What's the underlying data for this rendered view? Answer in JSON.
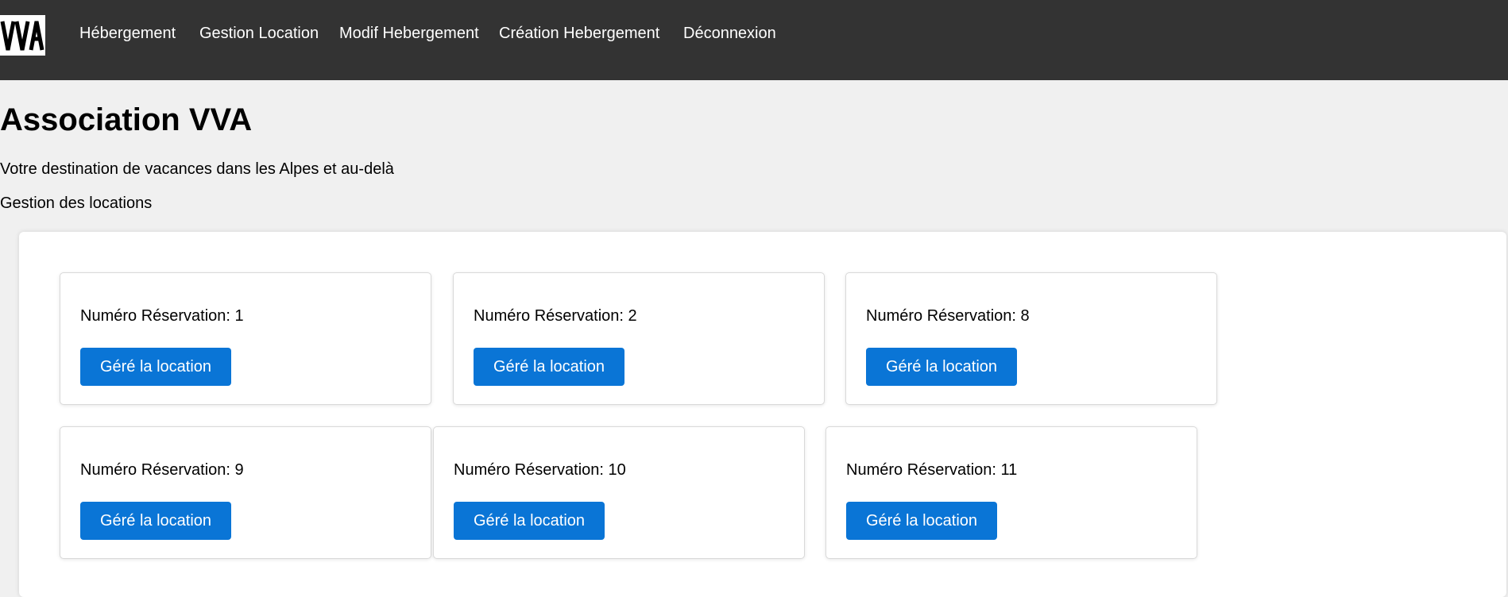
{
  "header": {
    "logo_text": "VVA",
    "nav": [
      {
        "label": "Hébergement"
      },
      {
        "label": "Gestion Location"
      },
      {
        "label": "Modif Hebergement"
      },
      {
        "label": "Création Hebergement"
      },
      {
        "label": "Déconnexion"
      }
    ],
    "background_color": "#333333"
  },
  "main": {
    "title": "Association VVA",
    "subtitle": "Votre destination de vacances dans les Alpes et au-delà",
    "section_label": "Gestion des locations",
    "cards": [
      {
        "label": "Numéro Réservation: 1",
        "button_label": "Géré la location"
      },
      {
        "label": "Numéro Réservation: 2",
        "button_label": "Géré la location"
      },
      {
        "label": "Numéro Réservation: 8",
        "button_label": "Géré la location"
      },
      {
        "label": "Numéro Réservation: 9",
        "button_label": "Géré la location"
      },
      {
        "label": "Numéro Réservation: 10",
        "button_label": "Géré la location"
      },
      {
        "label": "Numéro Réservation: 11",
        "button_label": "Géré la location"
      }
    ]
  },
  "colors": {
    "accent": "#0a75d6",
    "page_background": "#f0f0f0",
    "card_background": "#ffffff"
  }
}
